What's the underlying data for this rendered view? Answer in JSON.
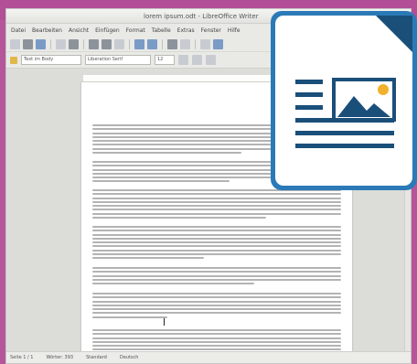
{
  "window": {
    "title": "lorem ipsum.odt - LibreOffice Writer"
  },
  "menubar": {
    "items": [
      "Datei",
      "Bearbeiten",
      "Ansicht",
      "Einfügen",
      "Format",
      "Tabelle",
      "Extras",
      "Fenster",
      "Hilfe"
    ]
  },
  "format_bar": {
    "style": "Text im Body",
    "font": "Liberation Serif",
    "size": "12"
  },
  "statusbar": {
    "page": "Seite 1 / 1",
    "words": "Wörter: 393",
    "style": "Standard",
    "language": "Deutsch"
  },
  "icons": {
    "logo": "libreoffice-writer-logo-icon"
  },
  "colors": {
    "background": "#b5569a",
    "logo_blue": "#2b7ab8",
    "logo_dark": "#1a4f7a",
    "logo_gold": "#f2b12a"
  }
}
